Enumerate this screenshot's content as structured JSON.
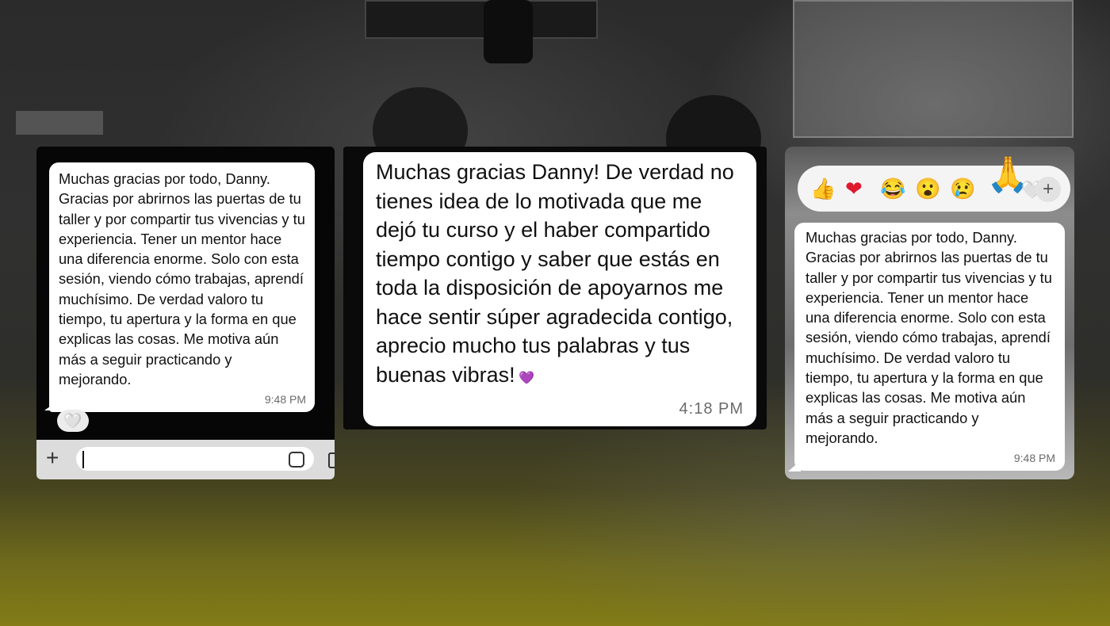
{
  "left_chat": {
    "message": "Muchas gracias por todo, Danny. Gracias por abrirnos las puertas de tu taller y por compartir tus vivencias y tu experiencia. Tener un mentor hace una diferencia enorme. Solo con esta sesión, viendo cómo trabajas, aprendí muchísimo. De verdad valoro tu tiempo, tu apertura y la forma en que explicas las cosas. Me motiva aún más a seguir practicando y mejorando.",
    "time": "9:48 PM",
    "reaction": "🤍",
    "input": {
      "placeholder": ""
    }
  },
  "center_chat": {
    "message": "Muchas gracias Danny! De verdad no tienes idea de lo motivada que me dejó tu curso y el haber compartido tiempo contigo y saber que estás en toda la disposición de apoyarnos me hace sentir súper agradecida contigo, aprecio mucho tus palabras y tus buenas vibras!",
    "emoji": "💜",
    "time": "4:18 PM"
  },
  "right_chat": {
    "reactions": {
      "thumbs_up": "👍",
      "heart": "❤",
      "laugh": "😂",
      "wow": "😮",
      "cry": "😢",
      "pray": "🙏",
      "white_heart": "🤍",
      "more": "+"
    },
    "message": "Muchas gracias por todo, Danny. Gracias por abrirnos las puertas de tu taller y por compartir tus vivencias y tu experiencia. Tener un mentor hace una diferencia enorme. Solo con esta sesión, viendo cómo trabajas, aprendí muchísimo. De verdad valoro tu tiempo, tu apertura y la forma en que explicas las cosas. Me motiva aún más a seguir practicando y mejorando.",
    "time": "9:48 PM"
  },
  "colors": {
    "bubble": "#ffffff",
    "heart_red": "#e0182e",
    "purple_heart": "#8b3de0",
    "bottom_tint": "#837c17"
  }
}
